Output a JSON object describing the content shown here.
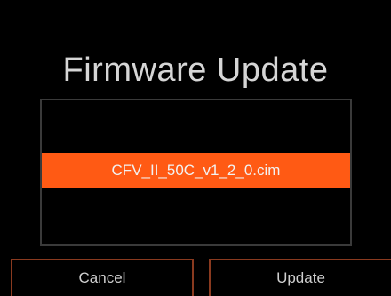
{
  "dialog": {
    "title": "Firmware Update",
    "files": [
      {
        "name": "CFV_II_50C_v1_2_0.cim",
        "selected": true
      }
    ],
    "buttons": {
      "cancel_label": "Cancel",
      "update_label": "Update"
    }
  },
  "colors": {
    "background": "#000000",
    "selection": "#ff5a14",
    "button_border": "#8a3a1f",
    "text": "#d6d6d6"
  }
}
